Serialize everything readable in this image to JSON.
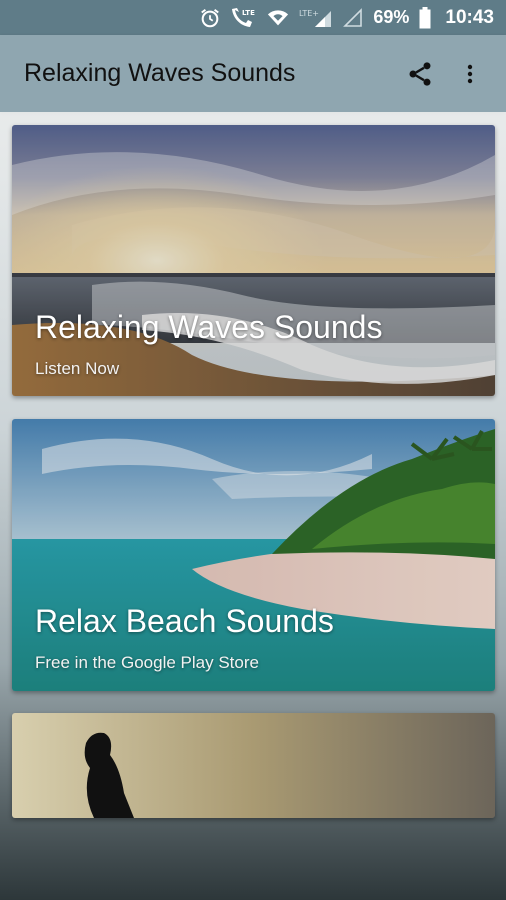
{
  "status_bar": {
    "network": "LTE",
    "network2": "LTE+",
    "battery": "69%",
    "time": "10:43",
    "icons": [
      "alarm-icon",
      "call-lte-icon",
      "wifi-icon",
      "signal-icon",
      "signal-empty-icon",
      "battery-icon"
    ]
  },
  "app_bar": {
    "title": "Relaxing Waves Sounds",
    "actions": [
      "share-icon",
      "more-vert-icon"
    ]
  },
  "cards": [
    {
      "title": "Relaxing Waves Sounds",
      "subtitle": "Listen Now"
    },
    {
      "title": "Relax Beach Sounds",
      "subtitle": "Free in the Google Play Store"
    },
    {
      "title": "",
      "subtitle": ""
    }
  ],
  "colors": {
    "status_bar": "#5f7c88",
    "app_bar": "#8fa6b0"
  }
}
